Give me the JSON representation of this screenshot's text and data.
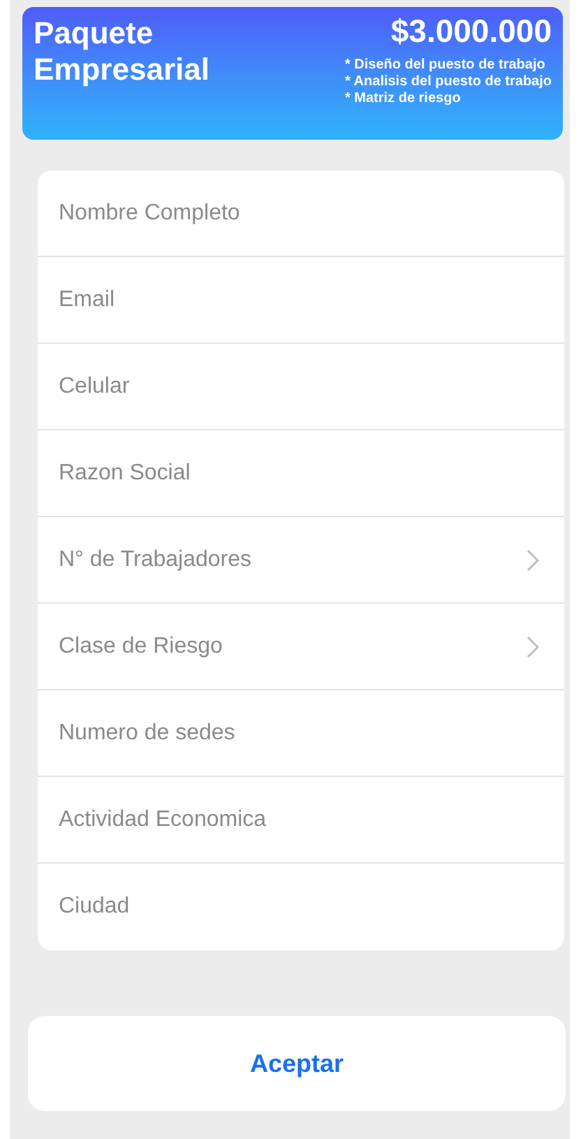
{
  "header": {
    "title": "Paquete Empresarial",
    "price": "$3.000.000",
    "features": [
      "* Diseño del puesto de trabajo",
      "* Analisis del puesto de trabajo",
      "* Matriz de riesgo"
    ]
  },
  "form": {
    "fields": [
      {
        "kind": "text",
        "placeholder": "Nombre Completo"
      },
      {
        "kind": "text",
        "placeholder": "Email"
      },
      {
        "kind": "text",
        "placeholder": "Celular"
      },
      {
        "kind": "text",
        "placeholder": "Razon Social"
      },
      {
        "kind": "select",
        "placeholder": "N° de Trabajadores"
      },
      {
        "kind": "select",
        "placeholder": "Clase de Riesgo"
      },
      {
        "kind": "text",
        "placeholder": "Numero de sedes"
      },
      {
        "kind": "text",
        "placeholder": "Actividad Economica"
      },
      {
        "kind": "text",
        "placeholder": "Ciudad"
      }
    ]
  },
  "submit": {
    "label": "Aceptar"
  }
}
